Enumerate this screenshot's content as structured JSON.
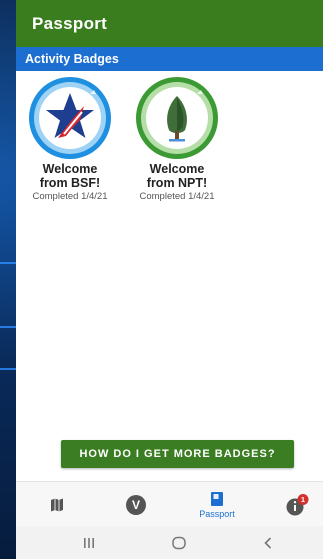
{
  "header": {
    "title": "Passport"
  },
  "section": {
    "title": "Activity Badges"
  },
  "badges": [
    {
      "name_line1": "Welcome",
      "name_line2": "from BSF!",
      "completed": "Completed 1/4/21"
    },
    {
      "name_line1": "Welcome",
      "name_line2": "from NPT!",
      "completed": "Completed 1/4/21"
    }
  ],
  "more_button": {
    "label": "HOW DO I GET MORE BADGES?"
  },
  "bottom_nav": {
    "v_icon_letter": "V",
    "passport_label": "Passport",
    "info_badge_count": "1",
    "active_color": "#1c6fd0"
  },
  "colors": {
    "header_green": "#3a7d1f",
    "section_blue": "#1c6fd0",
    "button_green": "#3b7d22",
    "notification_red": "#d32f2f"
  }
}
